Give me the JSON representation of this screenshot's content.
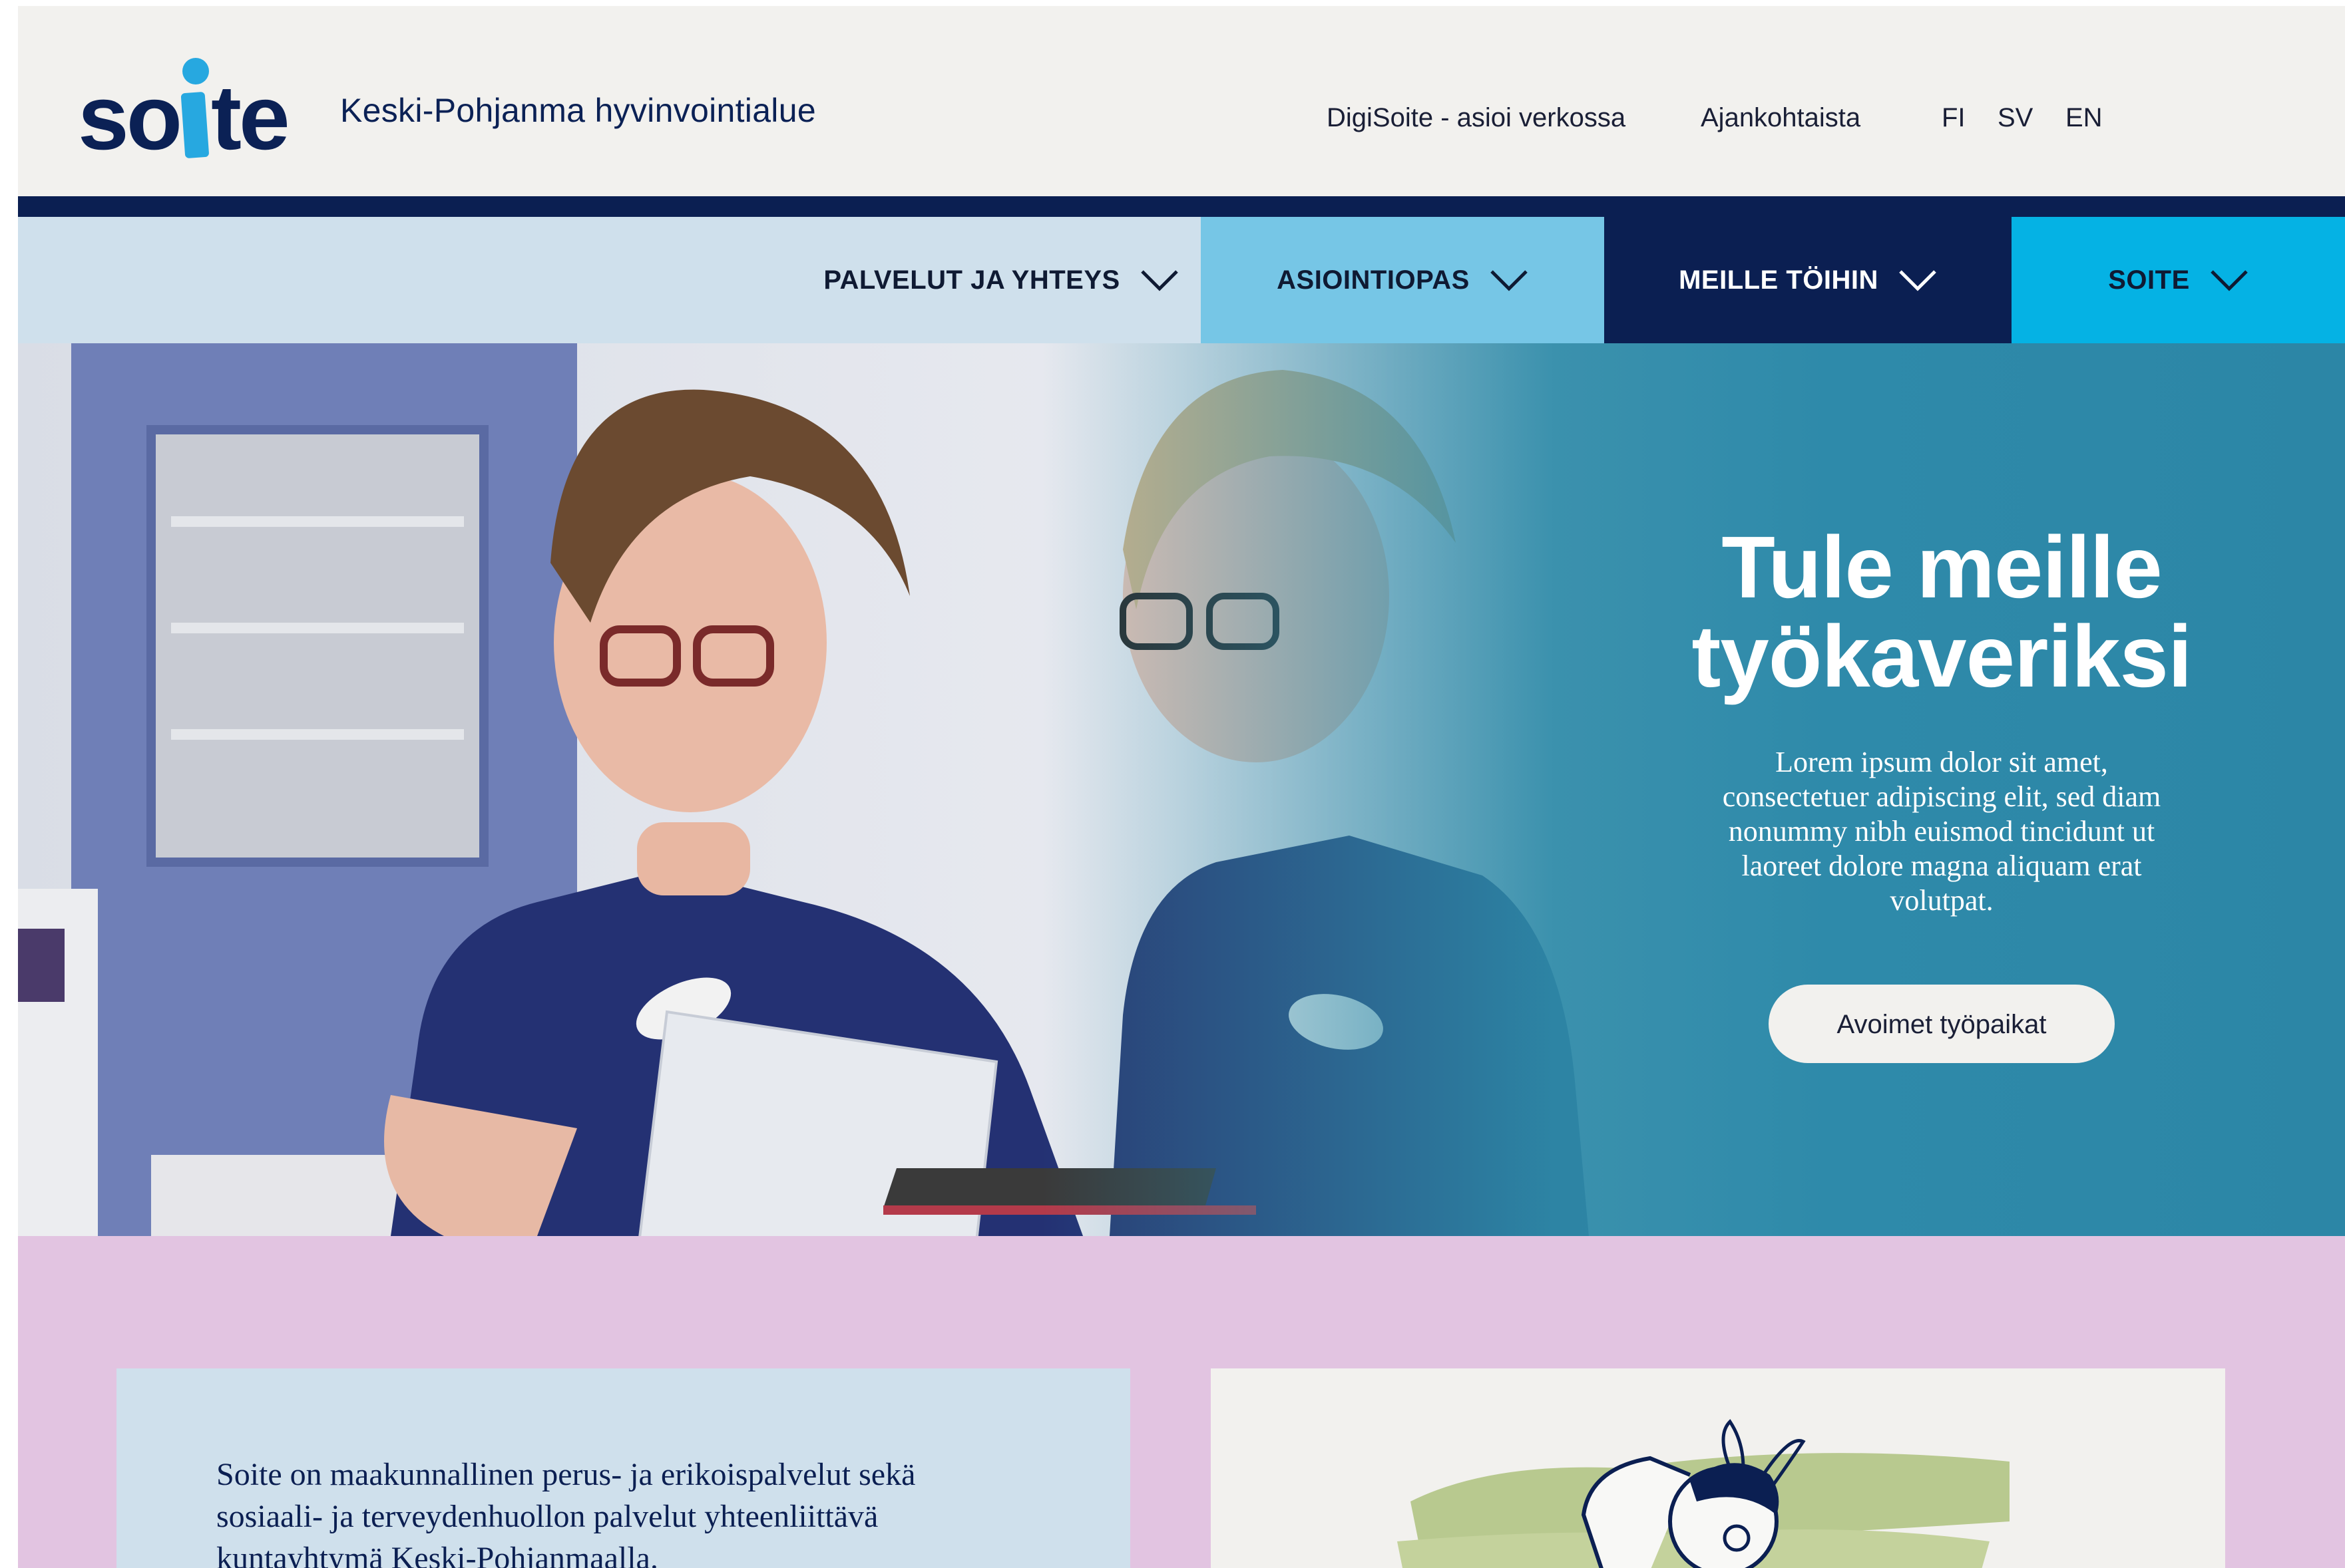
{
  "header": {
    "logo_text": "soite",
    "region_name": "Keski-Pohjanma hyvinvointialue",
    "utility_links": [
      "DigiSoite - asioi verkossa",
      "Ajankohtaista"
    ],
    "languages": [
      "FI",
      "SV",
      "EN"
    ]
  },
  "nav": {
    "tabs": [
      {
        "label": "PALVELUT JA YHTEYS"
      },
      {
        "label": "ASIOINTIOPAS"
      },
      {
        "label": "MEILLE TÖIHIN"
      },
      {
        "label": "SOITE"
      }
    ]
  },
  "hero": {
    "title_line1": "Tule meille",
    "title_line2": "työkaveriksi",
    "text": "Lorem ipsum dolor sit amet, consectetuer adipiscing elit, sed diam nonummy nibh euismod tincidunt ut laoreet dolore magna aliquam erat volutpat.",
    "cta_label": "Avoimet työpaikat"
  },
  "intro": {
    "text": "Soite on maakunnallinen perus- ja erikoispalvelut sekä sosiaali- ja terveydenhuollon palvelut yhteenliittävä kuntayhtymä Keski-Pohjanmaalla."
  },
  "colors": {
    "navy": "#0b1f52",
    "light_blue": "#cfe0ec",
    "sky": "#76c6e6",
    "cyan": "#05b2e4",
    "hero_teal": "#2e8aaa",
    "pink": "#e2c4e1",
    "cream": "#f2f1ee"
  },
  "icons": [
    "chevron-down-icon",
    "soite-logo",
    "person-icon"
  ]
}
